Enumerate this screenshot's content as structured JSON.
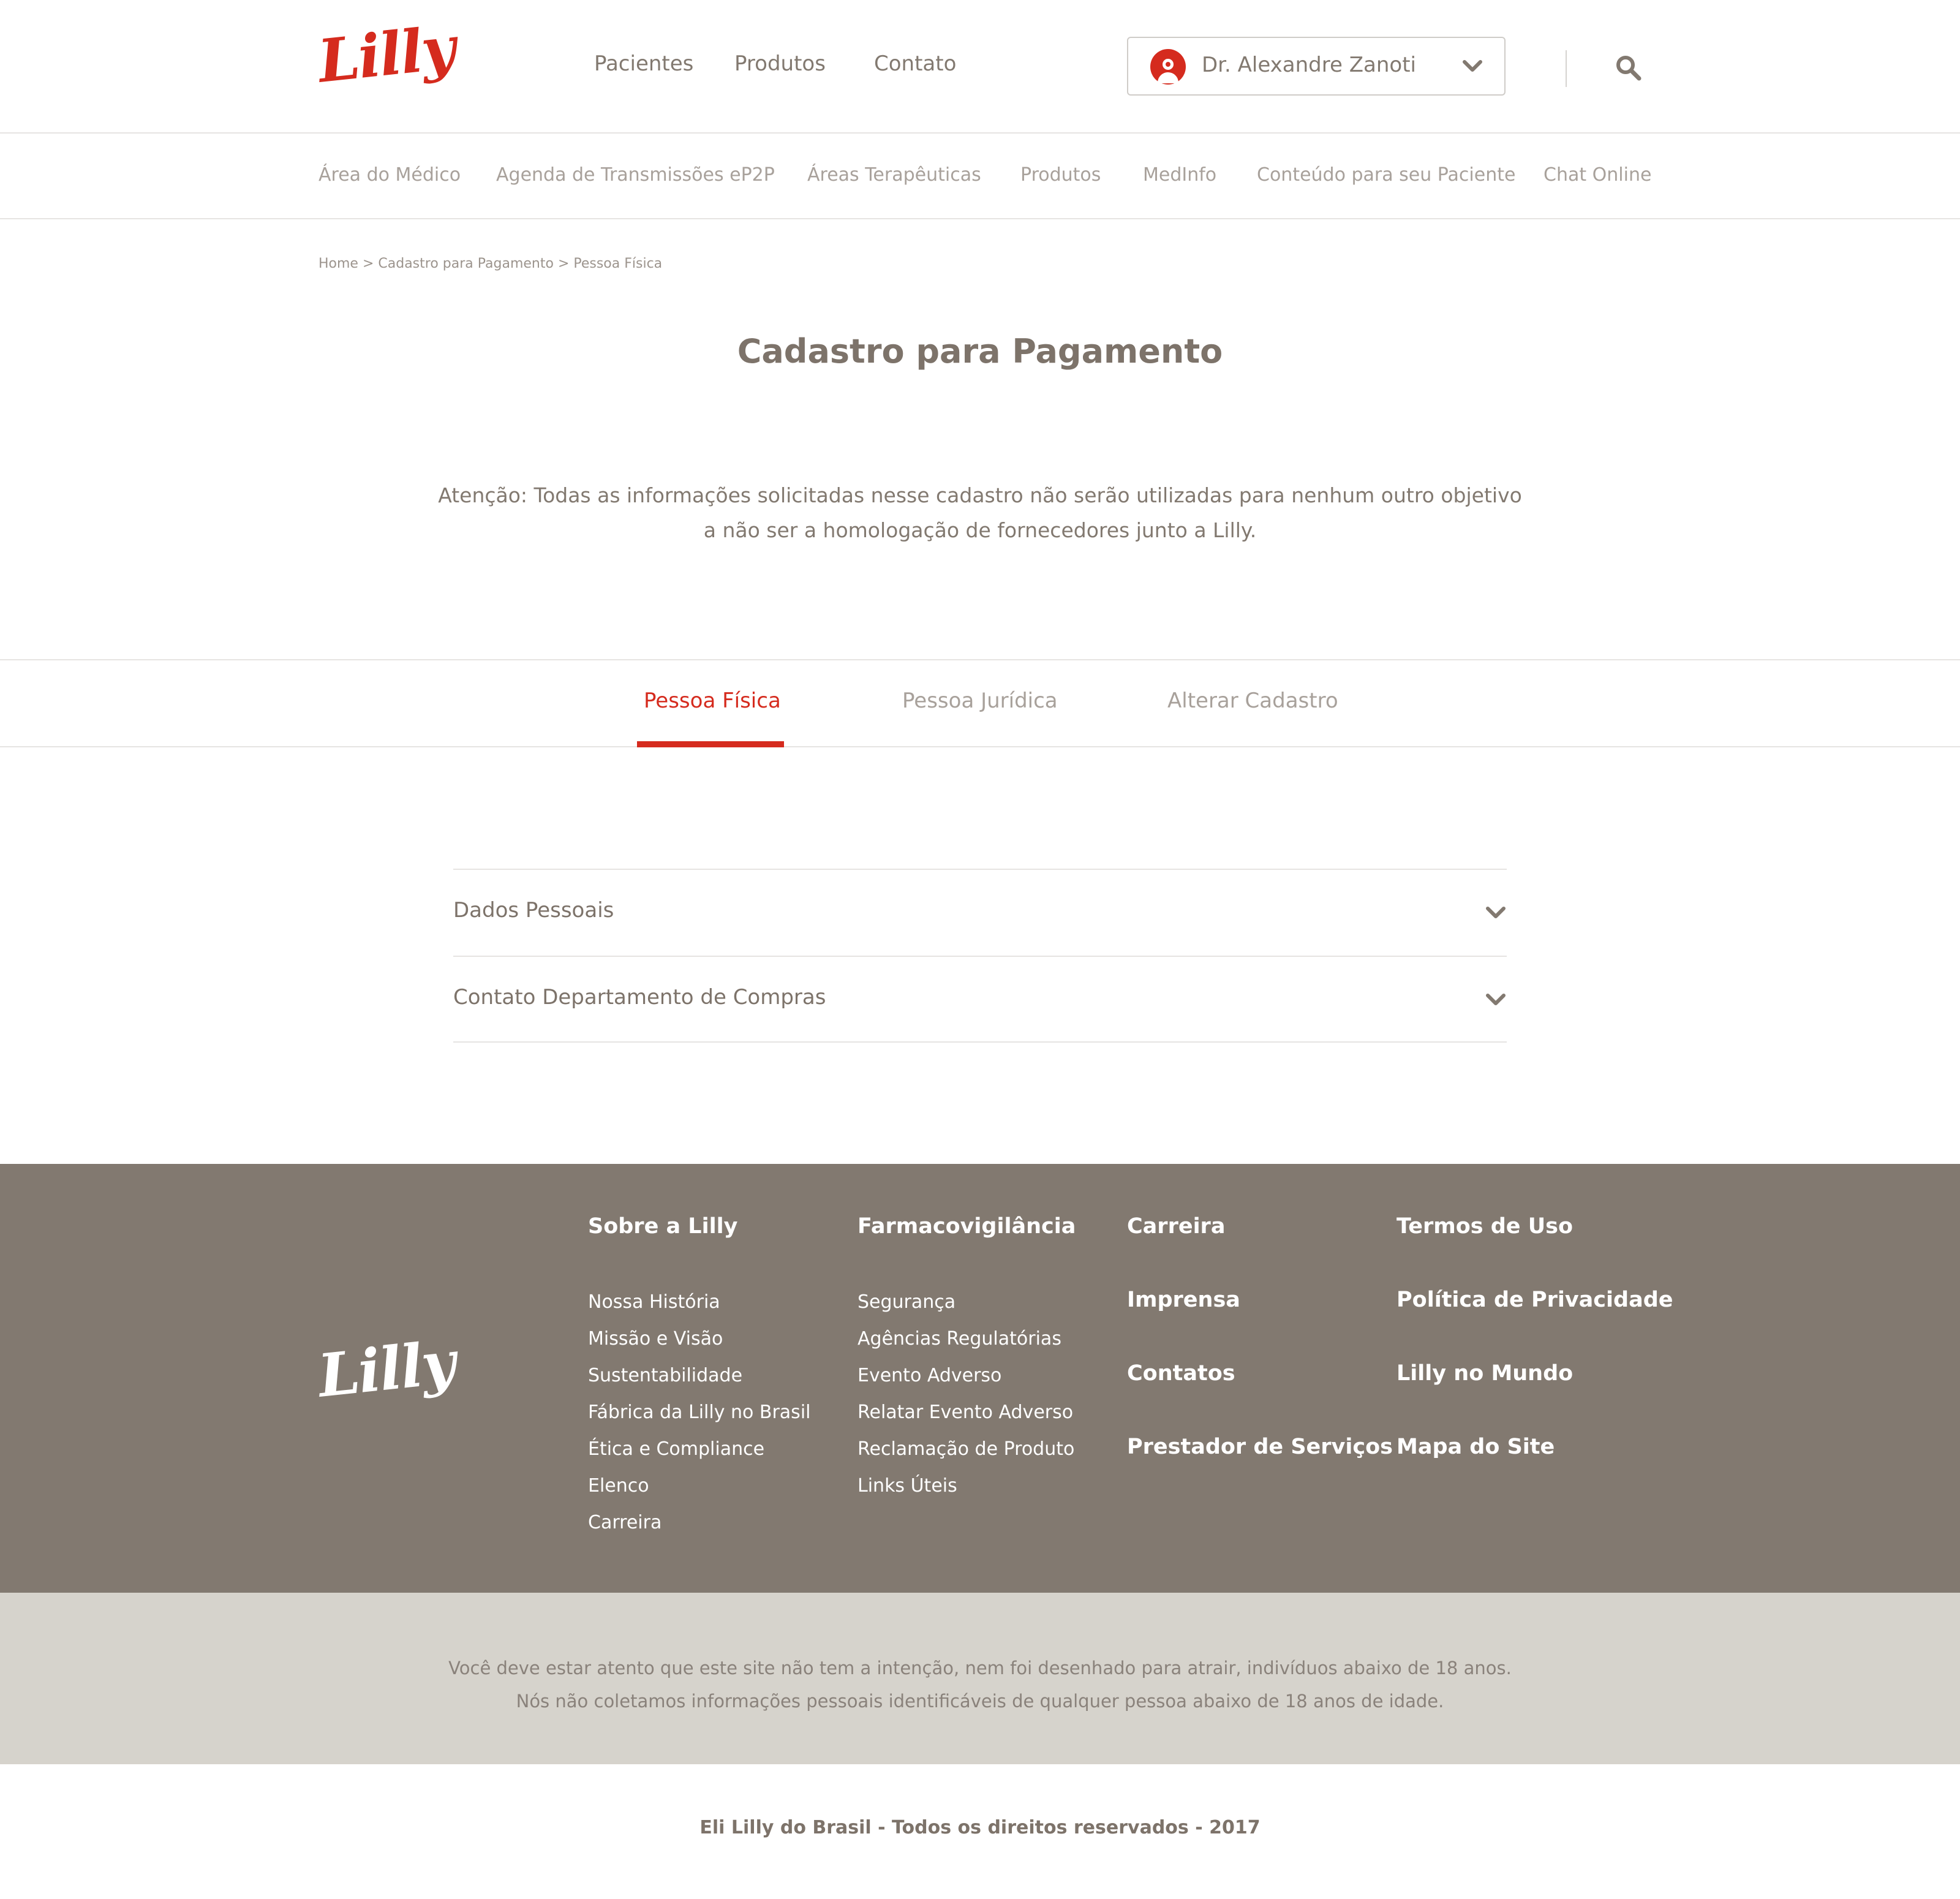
{
  "brand": {
    "logo_text": "Lilly",
    "accent_color": "#d52b1e",
    "footer_color": "#827970"
  },
  "header": {
    "nav": [
      "Pacientes",
      "Produtos",
      "Contato"
    ],
    "user": {
      "name": "Dr. Alexandre Zanoti",
      "icon": "user-avatar-icon"
    },
    "search_icon": "search-icon"
  },
  "subnav": [
    "Área do Médico",
    "Agenda de Transmissões eP2P",
    "Áreas Terapêuticas",
    "Produtos",
    "MedInfo",
    "Conteúdo para seu Paciente",
    "Chat Online"
  ],
  "breadcrumb": "Home > Cadastro para Pagamento > Pessoa Física",
  "page": {
    "title": "Cadastro para Pagamento",
    "notice_line1": "Atenção: Todas as informações solicitadas nesse cadastro não serão utilizadas para nenhum outro objetivo",
    "notice_line2": "a não ser a homologação de fornecedores junto a Lilly."
  },
  "tabs": [
    {
      "label": "Pessoa Física",
      "active": true
    },
    {
      "label": "Pessoa Jurídica",
      "active": false
    },
    {
      "label": "Alterar Cadastro",
      "active": false
    }
  ],
  "accordion": [
    {
      "title": "Dados Pessoais"
    },
    {
      "title": "Contato Departamento de Compras"
    }
  ],
  "footer": {
    "logo_text": "Lilly",
    "col1": {
      "heading": "Sobre a Lilly",
      "links": [
        "Nossa História",
        "Missão e Visão",
        "Sustentabilidade",
        "Fábrica da Lilly no Brasil",
        "Ética e Compliance",
        "Elenco",
        "Carreira"
      ]
    },
    "col2": {
      "heading": "Farmacovigilância",
      "links": [
        "Segurança",
        "Agências Regulatórias",
        "Evento Adverso",
        "Relatar Evento Adverso",
        "Reclamação de Produto",
        "Links Úteis"
      ]
    },
    "col3": [
      "Carreira",
      "Imprensa",
      "Contatos",
      "Prestador de Serviços"
    ],
    "col4": [
      "Termos de Uso",
      "Política de Privacidade",
      "Lilly no Mundo",
      "Mapa do Site"
    ]
  },
  "disclaimer": {
    "line1": "Você deve estar atento que este site não tem a intenção, nem foi desenhado para atrair, indivíduos abaixo de 18 anos.",
    "line2": "Nós não coletamos informações pessoais identificáveis de qualquer pessoa abaixo de 18 anos de idade."
  },
  "copyright": "Eli Lilly do Brasil - Todos os direitos reservados - 2017"
}
